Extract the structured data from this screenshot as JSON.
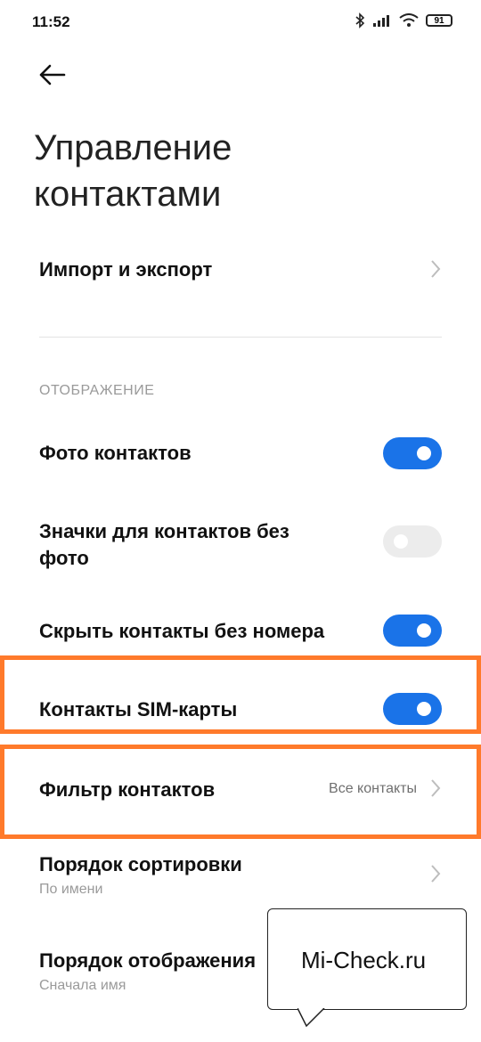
{
  "status_bar": {
    "time": "11:52",
    "battery": "91"
  },
  "title": "Управление контактами",
  "import_export": {
    "label": "Импорт и экспорт"
  },
  "section_display": "ОТОБРАЖЕНИЕ",
  "settings": {
    "contact_photos": {
      "label": "Фото контактов",
      "enabled": true
    },
    "icons_no_photo": {
      "label": "Значки для контактов без фото",
      "enabled": false
    },
    "hide_no_number": {
      "label": "Скрыть контакты без номера",
      "enabled": true
    },
    "sim_contacts": {
      "label": "Контакты SIM-карты",
      "enabled": true
    }
  },
  "contact_filter": {
    "label": "Фильтр контактов",
    "value": "Все контакты"
  },
  "sort_order": {
    "label": "Порядок сортировки",
    "value": "По имени"
  },
  "display_order": {
    "label": "Порядок отображения",
    "value": "Сначала имя"
  },
  "callout": "Mi-Check.ru",
  "colors": {
    "accent": "#1a73e8",
    "highlight": "#ff7a2b"
  }
}
